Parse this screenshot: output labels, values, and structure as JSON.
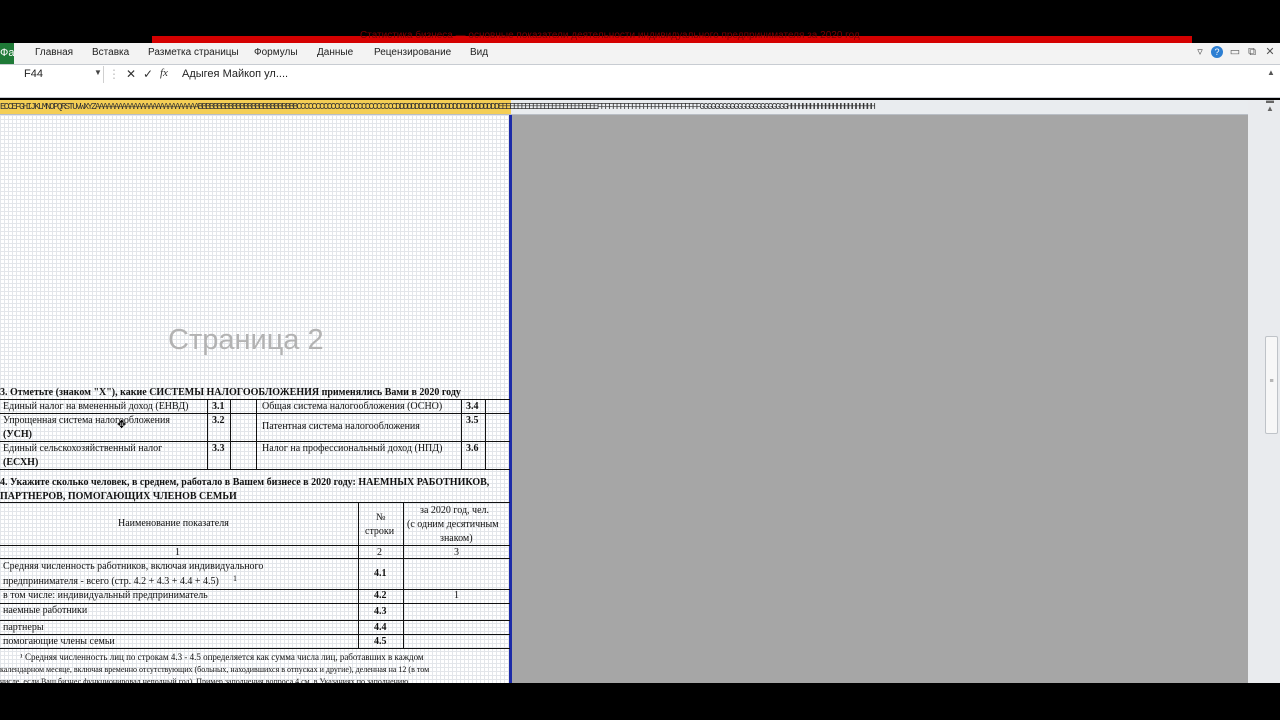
{
  "window": {
    "title": "Статистика бизнеса — основные показатели деятельности индивидуального предпринимателя за 2020 год"
  },
  "ribbon": {
    "file_tab": "Файл",
    "tabs": [
      "Главная",
      "Вставка",
      "Разметка страницы",
      "Формулы",
      "Данные",
      "Рецензирование",
      "Вид"
    ],
    "icons": [
      "ribbon-minimize-icon",
      "help-icon",
      "minimize-icon",
      "restore-icon",
      "close-icon"
    ]
  },
  "formula_bar": {
    "name_box": "F44",
    "cancel_glyph": "✕",
    "enter_glyph": "✓",
    "fx_glyph": "fx",
    "formula": "Адыгея Майкоп ул...."
  },
  "column_header": {
    "text": "ECCEFGHIJKLMNOPQRSTUVWXYZAAAAAAAAAAAAAAAAAAAAAAAAAAABBBBBBBBBBBBBBBBBBBBBBBBBBCCCCCCCCCCCCCCCCCCCCCCCCCCDDDDDDDDDDDDDDDDDDDDDDDDDDDEEEEEEEEEEEEEEEEEEEEEEEEEEFFFFFFFFFFFFFFFFFFFFFFFFFFFGGGGGGGGGGGGGGGGGGGGGGGHHHHHHHHHHHHHHHHHHHHHHH"
  },
  "sheet": {
    "watermark": "Страница 2",
    "section3": {
      "title": "3. Отметьте (знаком \"X\"), какие СИСТЕМЫ НАЛОГООБЛОЖЕНИЯ применялись Вами в 2020 году",
      "rows": [
        {
          "left_label": "Единый налог на вмененный доход (ЕНВД)",
          "left_code": "3.1",
          "right_label": "Общая система налогообложения (ОСНО)",
          "right_code": "3.4"
        },
        {
          "left_label_1": "Упрощенная система налогообложения",
          "left_label_2": "(УСН)",
          "left_code": "3.2",
          "right_label": "Патентная система налогообложения",
          "right_code": "3.5"
        },
        {
          "left_label_1": "Единый сельскохозяйственный налог",
          "left_label_2": "(ЕСХН)",
          "left_code": "3.3",
          "right_label": "Налог на профессиональный доход (НПД)",
          "right_code": "3.6"
        }
      ]
    },
    "section4": {
      "title_1": "4. Укажите сколько человек, в среднем, работало в Вашем бизнесе в 2020 году: НАЕМНЫХ РАБОТНИКОВ,",
      "title_2": "ПАРТНЕРОВ, ПОМОГАЮЩИХ ЧЛЕНОВ СЕМЬИ",
      "header": {
        "name": "Наименование показателя",
        "num_1": "№",
        "num_2": "строки",
        "val_1": "за 2020 год, чел.",
        "val_2": "(с одним десятичным",
        "val_3": "знаком)"
      },
      "index_row": [
        "1",
        "2",
        "3"
      ],
      "rows": [
        {
          "label_1": "Средняя численность работников, включая индивидуального",
          "label_2": "предпринимателя - всего (стр. 4.2 + 4.3 + 4.4 + 4.5)",
          "sup": "1",
          "code": "4.1",
          "value": ""
        },
        {
          "label": "в том числе: индивидуальный предприниматель",
          "code": "4.2",
          "value": "1"
        },
        {
          "label": "наемные работники",
          "code": "4.3",
          "value": ""
        },
        {
          "label": "партнеры",
          "code": "4.4",
          "value": ""
        },
        {
          "label": "помогающие члены семьи",
          "code": "4.5",
          "value": ""
        }
      ],
      "footnote_1": "¹  Средняя численность лиц по строкам 4.3 - 4.5 определяется как сумма числа лиц, работавших в каждом",
      "footnote_2": "календарном месяце, включая временно отсутствующих (больных, находившихся в отпусках и другие), деленная на 12 (в том",
      "footnote_3": "числе, если Ваш бизнес функционировал неполный год). Пример заполнения вопроса 4 см. в Указаниях по заполнению"
    }
  }
}
